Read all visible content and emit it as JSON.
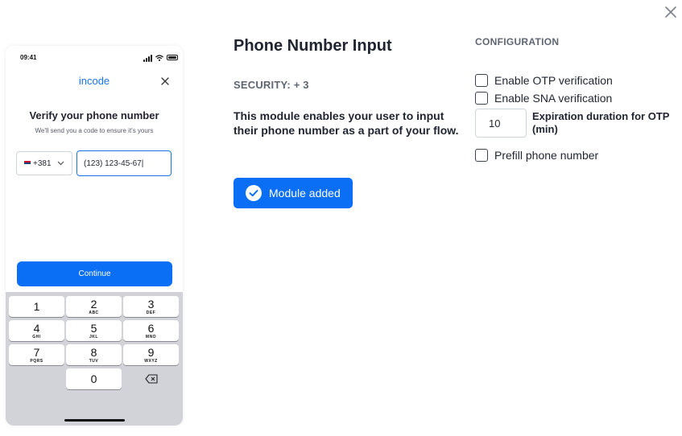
{
  "window": {
    "close_icon": "close-icon"
  },
  "phone_preview": {
    "status_time": "09:41",
    "app_name": "incode",
    "title": "Verify your phone number",
    "subtitle": "We'll send you a code to ensure it's yours",
    "country_code": "+381",
    "phone_value": "(123) 123-45-67|",
    "continue_label": "Continue",
    "keypad": [
      {
        "digit": "1",
        "letters": ""
      },
      {
        "digit": "2",
        "letters": "ABC"
      },
      {
        "digit": "3",
        "letters": "DEF"
      },
      {
        "digit": "4",
        "letters": "GHI"
      },
      {
        "digit": "5",
        "letters": "JKL"
      },
      {
        "digit": "6",
        "letters": "MNO"
      },
      {
        "digit": "7",
        "letters": "PQRS"
      },
      {
        "digit": "8",
        "letters": "TUV"
      },
      {
        "digit": "9",
        "letters": "WXYZ"
      },
      {
        "digit": "0",
        "letters": ""
      }
    ]
  },
  "module": {
    "title": "Phone Number Input",
    "security": "SECURITY: + 3",
    "description": "This module enables your user to input their phone number as a part of your flow.",
    "added_label": "Module added",
    "accent_color": "#0b6ff5"
  },
  "configuration": {
    "heading": "CONFIGURATION",
    "otp_label": "Enable OTP verification",
    "sna_label": "Enable SNA verification",
    "duration_value": "10",
    "duration_label": "Expiration duration for OTP (min)",
    "prefill_label": "Prefill phone number"
  }
}
